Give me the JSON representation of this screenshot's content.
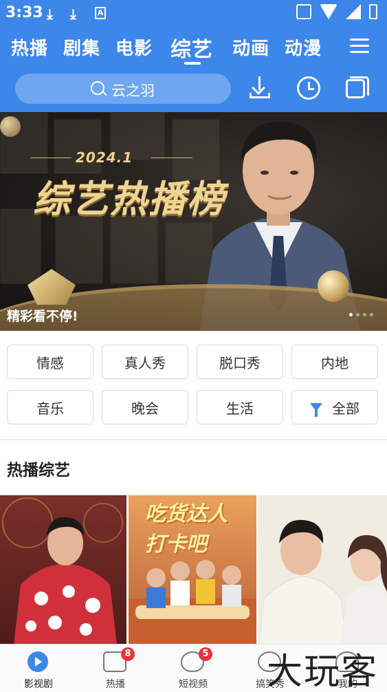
{
  "status_bar": {
    "time": "3:33",
    "ab_icon_text": "A"
  },
  "tabs": [
    {
      "label": "热播",
      "active": false
    },
    {
      "label": "剧集",
      "active": false
    },
    {
      "label": "电影",
      "active": false
    },
    {
      "label": "综艺",
      "active": true
    },
    {
      "label": "动画",
      "active": false
    },
    {
      "label": "动漫",
      "active": false
    }
  ],
  "search": {
    "text": "云之羽"
  },
  "banner": {
    "date": "2024.1",
    "title": "综艺热播榜",
    "caption": "精彩看不停!",
    "slide_count": 4,
    "active_slide": 1
  },
  "categories": [
    {
      "label": "情感"
    },
    {
      "label": "真人秀"
    },
    {
      "label": "脱口秀"
    },
    {
      "label": "内地"
    },
    {
      "label": "音乐"
    },
    {
      "label": "晚会"
    },
    {
      "label": "生活"
    },
    {
      "label": "全部",
      "icon": "filter-icon"
    }
  ],
  "section": {
    "title": "热播综艺"
  },
  "thumbnails": [
    {
      "poster_text": ""
    },
    {
      "poster_text": "吃货达人打卡吧"
    },
    {
      "poster_text": ""
    }
  ],
  "bottom_nav": [
    {
      "label": "影视剧",
      "icon": "play-icon",
      "active": true,
      "badge": ""
    },
    {
      "label": "热播",
      "icon": "tv-icon",
      "active": false,
      "badge": "8"
    },
    {
      "label": "短视频",
      "icon": "fire-icon",
      "active": false,
      "badge": "5"
    },
    {
      "label": "搞笑秀",
      "icon": "smile-icon",
      "active": false,
      "badge": ""
    },
    {
      "label": "我的",
      "icon": "user-icon",
      "active": false,
      "badge": ""
    }
  ],
  "watermark": "大玩客",
  "colors": {
    "accent": "#3d86ea",
    "badge": "#e8343a",
    "banner_gold": "#f0d492"
  }
}
